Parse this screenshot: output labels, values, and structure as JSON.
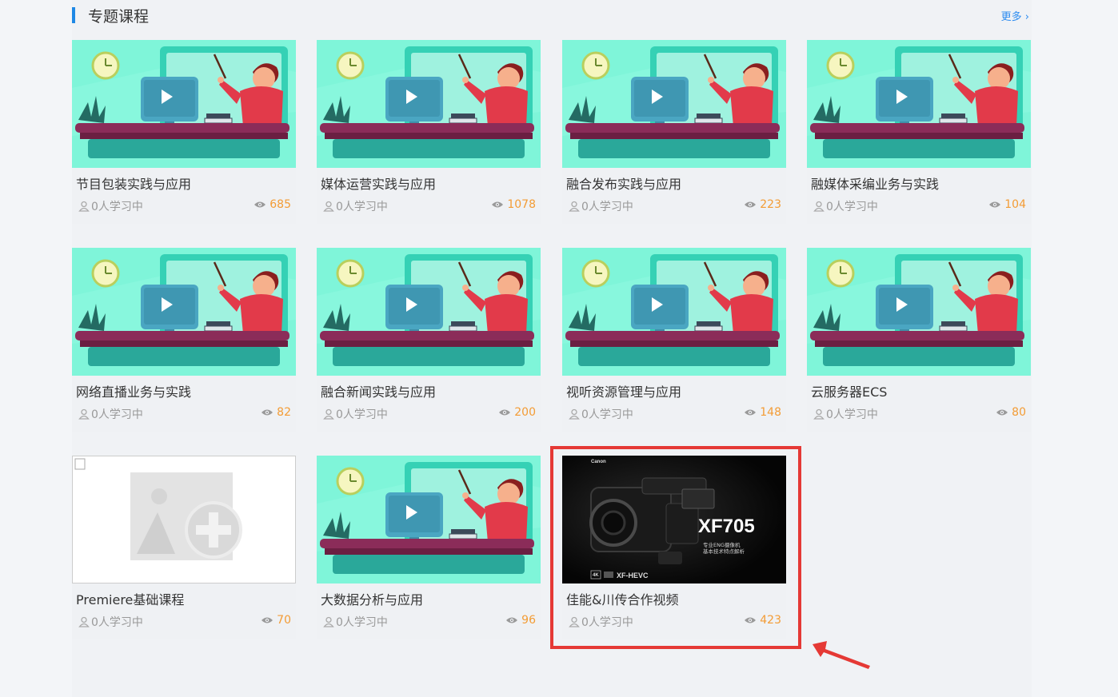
{
  "section": {
    "title": "专题课程",
    "more": "更多 ›",
    "accent_color": "#1e88e5"
  },
  "courses": [
    {
      "title": "节目包装实践与应用",
      "learners": "0人学习中",
      "views": "685",
      "thumb": "teacher-illustration"
    },
    {
      "title": "媒体运营实践与应用",
      "learners": "0人学习中",
      "views": "1078",
      "thumb": "teacher-illustration"
    },
    {
      "title": "融合发布实践与应用",
      "learners": "0人学习中",
      "views": "223",
      "thumb": "teacher-illustration"
    },
    {
      "title": "融媒体采编业务与实践",
      "learners": "0人学习中",
      "views": "104",
      "thumb": "teacher-illustration"
    },
    {
      "title": "网络直播业务与实践",
      "learners": "0人学习中",
      "views": "82",
      "thumb": "teacher-illustration"
    },
    {
      "title": "融合新闻实践与应用",
      "learners": "0人学习中",
      "views": "200",
      "thumb": "teacher-illustration"
    },
    {
      "title": "视听资源管理与应用",
      "learners": "0人学习中",
      "views": "148",
      "thumb": "teacher-illustration"
    },
    {
      "title": "云服务器ECS",
      "learners": "0人学习中",
      "views": "80",
      "thumb": "teacher-illustration"
    },
    {
      "title": "Premiere基础课程",
      "learners": "0人学习中",
      "views": "70",
      "thumb": "broken-image-placeholder"
    },
    {
      "title": "大数据分析与应用",
      "learners": "0人学习中",
      "views": "96",
      "thumb": "teacher-illustration"
    },
    {
      "title": "佳能&川传合作视频",
      "learners": "0人学习中",
      "views": "423",
      "thumb": "camera-photo",
      "thumb_text": {
        "brand": "Canon",
        "model": "XF705",
        "line1": "专业ENG摄像机",
        "line2": "基本技术特点解析",
        "badge1": "4K",
        "badge2": "XF-HEVC"
      }
    }
  ],
  "colors": {
    "views": "#f39c35",
    "muted": "#999999",
    "highlight": "#e53935"
  }
}
